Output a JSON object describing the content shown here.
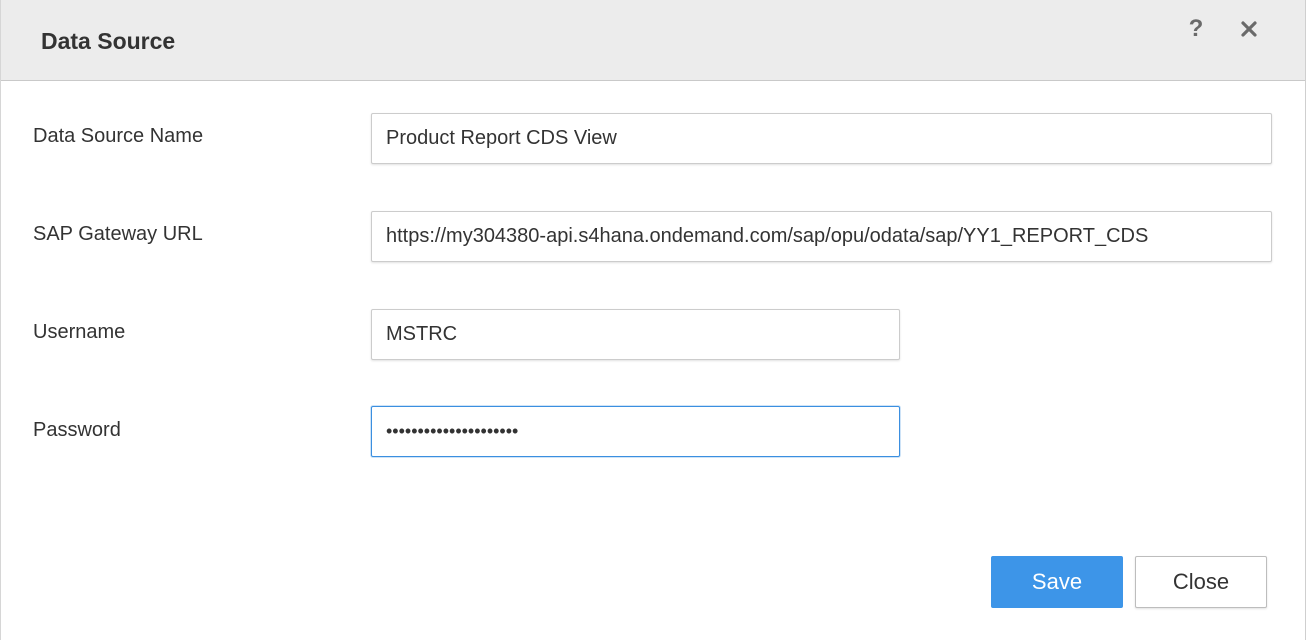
{
  "dialog": {
    "title": "Data Source",
    "help_label": "?",
    "icons": {
      "help": "help-icon",
      "close": "close-icon"
    }
  },
  "form": {
    "data_source_name": {
      "label": "Data Source Name",
      "value": "Product Report CDS View"
    },
    "gateway_url": {
      "label": "SAP Gateway URL",
      "value": "https://my304380-api.s4hana.ondemand.com/sap/opu/odata/sap/YY1_REPORT_CDS"
    },
    "username": {
      "label": "Username",
      "value": "MSTRC"
    },
    "password": {
      "label": "Password",
      "value": "•••••••••••••••••••••"
    }
  },
  "buttons": {
    "save_label": "Save",
    "close_label": "Close"
  },
  "colors": {
    "header_bg": "#ececec",
    "primary": "#3d95e8",
    "focus_border": "#3b8fe0"
  }
}
